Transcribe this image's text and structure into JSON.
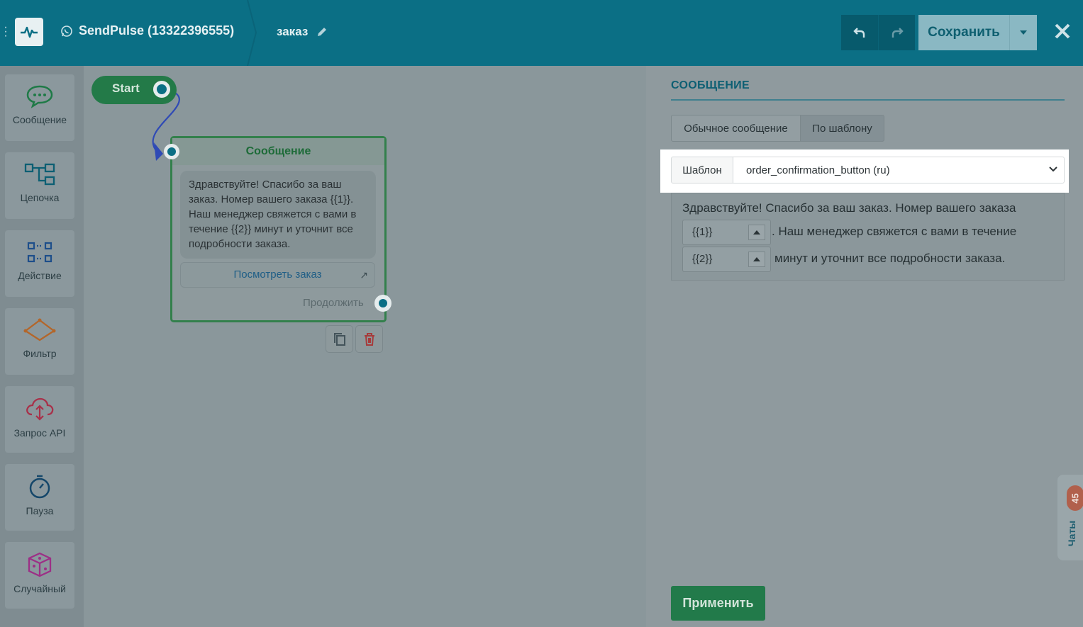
{
  "header": {
    "bot_name": "SendPulse (13322396555)",
    "flow_name": "заказ",
    "save_label": "Сохранить"
  },
  "sidebar": {
    "items": [
      {
        "label": "Сообщение",
        "icon": "chat-bubble-icon"
      },
      {
        "label": "Цепочка",
        "icon": "chain-icon"
      },
      {
        "label": "Действие",
        "icon": "action-icon"
      },
      {
        "label": "Фильтр",
        "icon": "filter-icon"
      },
      {
        "label": "Запрос API",
        "icon": "cloud-api-icon"
      },
      {
        "label": "Пауза",
        "icon": "stopwatch-icon"
      },
      {
        "label": "Случайный",
        "icon": "dice-icon"
      }
    ]
  },
  "canvas": {
    "start_label": "Start",
    "node": {
      "title": "Сообщение",
      "text": "Здравствуйте! Спасибо за ваш заказ. Номер вашего заказа {{1}}. Наш менеджер свяжется с вами в течение {{2}} минут и уточнит все подробности заказа.",
      "button_label": "Посмотреть заказ",
      "continue_label": "Продолжить"
    }
  },
  "panel": {
    "title": "СООБЩЕНИЕ",
    "tabs": [
      "Обычное сообщение",
      "По шаблону"
    ],
    "active_tab": "По шаблону",
    "template_label": "Шаблон",
    "template_value": "order_confirmation_button (ru)",
    "preview": {
      "part1": "Здравствуйте! Спасибо за ваш заказ. Номер вашего заказа",
      "var1": "{{1}}",
      "part2": ". Наш менеджер свяжется с вами в течение",
      "var2": "{{2}}",
      "part3": "минут и уточнит все подробности заказа."
    },
    "apply_label": "Применить"
  },
  "chats": {
    "label": "Чаты",
    "count": "45"
  },
  "colors": {
    "topbar": "#0b6f85",
    "accent_green": "#227a4a",
    "link_blue": "#1f5e86"
  }
}
